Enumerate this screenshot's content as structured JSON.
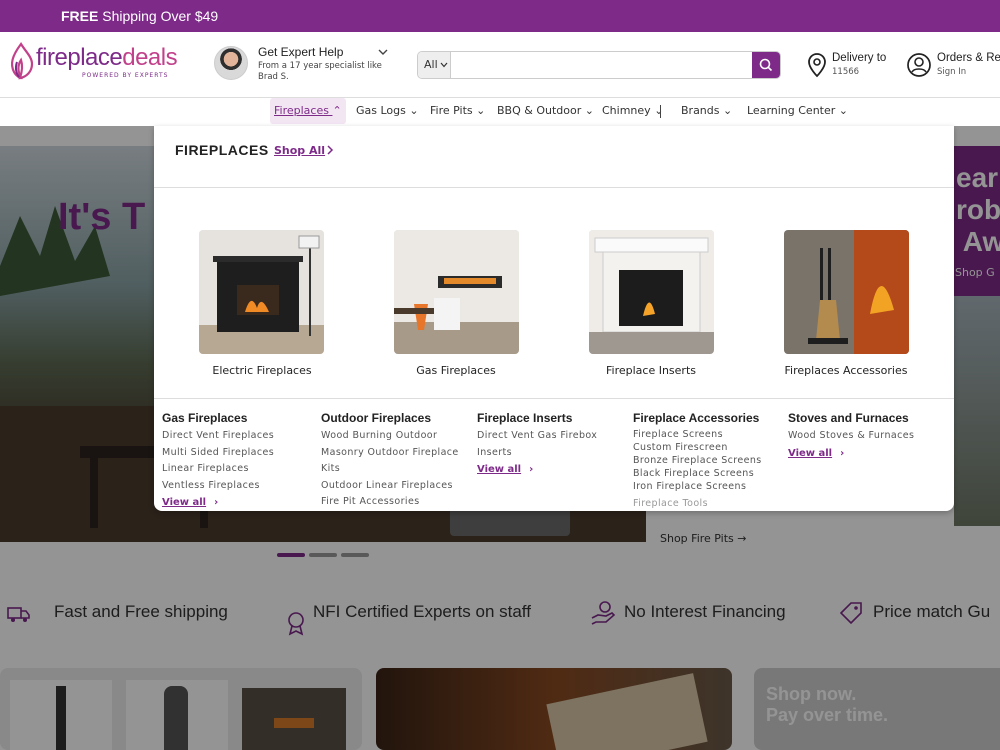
{
  "promo": {
    "bold": "FREE",
    "text": " Shipping Over $49"
  },
  "logo": {
    "word_a": "fireplace",
    "word_b": "deals",
    "tagline": "POWERED BY EXPERTS"
  },
  "expert": {
    "title": "Get Expert Help",
    "subtitle": "From a 17 year specialist like Brad S."
  },
  "search": {
    "category": "All",
    "placeholder": "",
    "value": ""
  },
  "delivery": {
    "title": "Delivery to",
    "zip": "11566"
  },
  "orders": {
    "title": "Orders & Returns",
    "subtitle": "Sign In"
  },
  "nav": {
    "items": [
      "Fireplaces",
      "Gas Logs",
      "Fire Pits",
      "BBQ & Outdoor",
      "Chimney",
      "Brands",
      "Learning Center"
    ]
  },
  "hero": {
    "headline": "It's T",
    "right_text": "ear\nrob\n Aw",
    "right_link": "Shop G",
    "firepit_link": "Shop Fire Pits →"
  },
  "usps": [
    "Fast and Free shipping",
    "NFI Certified Experts on staff",
    "No Interest Financing",
    "Price match Gu"
  ],
  "bottom": {
    "promo_text": "Shop now.\nPay over time."
  },
  "dropdown": {
    "title": "FIREPLACES",
    "shop_all": "Shop All",
    "tiles": [
      "Electric Fireplaces",
      "Gas Fireplaces",
      "Fireplace Inserts",
      "Fireplaces Accessories"
    ],
    "columns": [
      {
        "heading": "Gas Fireplaces",
        "links": [
          "Direct Vent Fireplaces",
          "Multi Sided Fireplaces",
          "Linear Fireplaces",
          "Ventless Fireplaces"
        ],
        "view_all": "View all"
      },
      {
        "heading": "Outdoor Fireplaces",
        "links": [
          "Wood Burning Outdoor",
          "Masonry Outdoor Fireplace",
          "Kits",
          "Outdoor Linear Fireplaces",
          "Fire Pit Accessories"
        ],
        "view_all": ""
      },
      {
        "heading": "Fireplace Inserts",
        "links": [
          "Direct Vent Gas Firebox",
          "Inserts"
        ],
        "view_all": "View all"
      },
      {
        "heading": "Fireplace Accessories",
        "links": [
          "Fireplace Screens",
          "Custom Firescreen",
          "Bronze Fireplace Screens",
          "Black Fireplace Screens",
          "Iron Fireplace Screens",
          "Fireplace Tools"
        ],
        "view_all": ""
      },
      {
        "heading": "Stoves and Furnaces",
        "links": [
          "Wood Stoves & Furnaces"
        ],
        "view_all": "View all"
      }
    ]
  },
  "colors": {
    "brand": "#7d2a89",
    "accent": "#c2418b"
  }
}
